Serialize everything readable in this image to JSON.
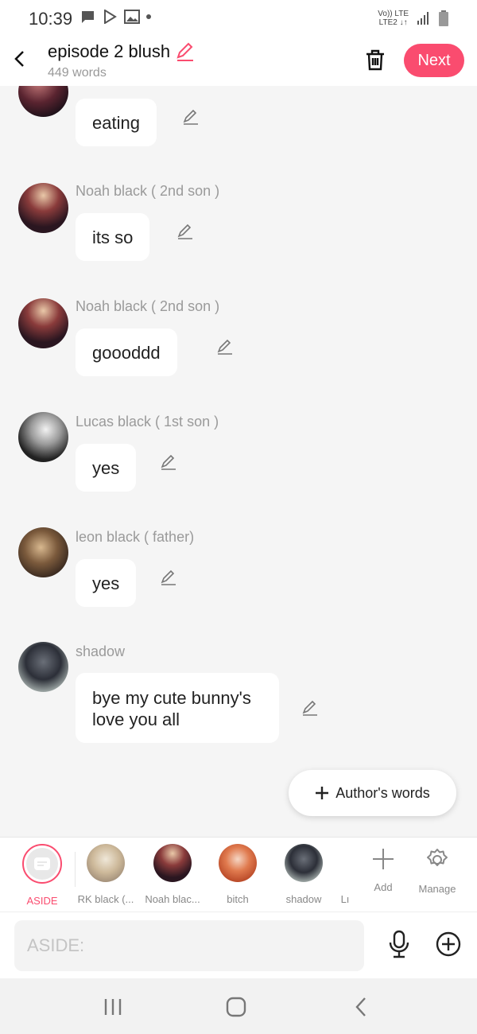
{
  "status_bar": {
    "time": "10:39",
    "network_top": "Vo)) LTE",
    "network_bottom": "LTE2 ↓↑"
  },
  "header": {
    "title": "episode 2 blush",
    "word_count": "449 words",
    "next_label": "Next"
  },
  "messages": [
    {
      "sender": "",
      "text": "eating"
    },
    {
      "sender": "Noah black ( 2nd son )",
      "text": "its so"
    },
    {
      "sender": "Noah black ( 2nd son )",
      "text": "goooddd"
    },
    {
      "sender": "Lucas  black ( 1st  son )",
      "text": "yes"
    },
    {
      "sender": "leon black ( father)",
      "text": "yes"
    },
    {
      "sender": "shadow",
      "text": "bye my cute bunny's love you all"
    }
  ],
  "author_words_label": "Author's words",
  "characters": [
    {
      "label": "ASIDE"
    },
    {
      "label": "RK black (..."
    },
    {
      "label": "Noah blac..."
    },
    {
      "label": "bitch"
    },
    {
      "label": "shadow"
    },
    {
      "label": "Lı"
    }
  ],
  "tools": {
    "add_label": "Add",
    "manage_label": "Manage"
  },
  "input": {
    "placeholder": "ASIDE:"
  },
  "colors": {
    "accent": "#fa4c6f",
    "background": "#f5f5f5",
    "bubble": "#ffffff"
  }
}
